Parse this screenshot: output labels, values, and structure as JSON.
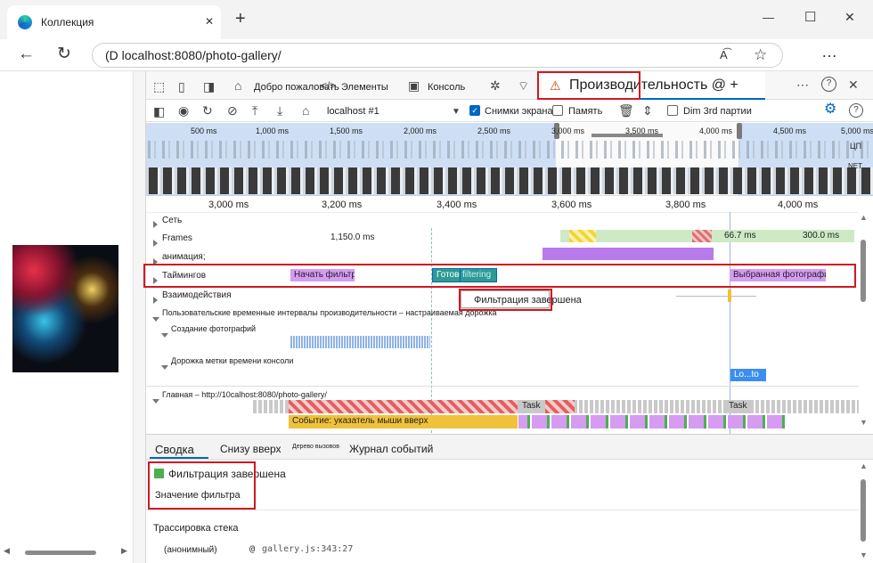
{
  "browser": {
    "tab_title": "Коллекция",
    "new_tab": "+",
    "min": "—",
    "max": "☐",
    "close": "✕",
    "url": "(D localhost:8080/photo-gallery/",
    "read_aloud": "A͡",
    "favorite": "☆",
    "more": "…"
  },
  "devtools": {
    "tabs": [
      {
        "label": "Добро пожаловать"
      },
      {
        "label": "Элементы"
      },
      {
        "label": "Консоль"
      },
      {
        "label": "Производительность @ +"
      }
    ],
    "more": "⋯",
    "help": "?",
    "close": "✕",
    "toolbar": {
      "target": "localhost #1",
      "screenshots": "Снимки экрана",
      "memory": "Память",
      "dim3rd": "Dim 3rd партии",
      "help": "?"
    },
    "overview": {
      "ticks": [
        "500 ms",
        "1,000 ms",
        "1,500 ms",
        "2,000 ms",
        "2,500 ms",
        "3,000 ms",
        "3,500 ms",
        "4,000 ms",
        "4,500 ms",
        "5,000 ms"
      ],
      "cpu": "ЦП",
      "net": "NET"
    },
    "ruler": [
      "3,000 ms",
      "3,200 ms",
      "3,400 ms",
      "3,600 ms",
      "3,800 ms",
      "4,000 ms"
    ],
    "tracks": {
      "network": "Сеть",
      "frames": "Frames",
      "frame_t1": "1,150.0 ms",
      "frame_t2": "66.7 ms",
      "frame_t3": "300.0 ms",
      "animation": "анимация;",
      "timings": "Таймингов",
      "start_filter": "Начать фильтрацию",
      "ready": "Готово",
      "filtering": "filtering",
      "selected_photo": "Выбранная фотография",
      "tooltip": "Фильтрация завершена",
      "interactions": "Взаимодействия",
      "user_timings": "Пользовательские временные интервалы производительности – настраиваемая дорожка",
      "create_photos": "Создание фотографий",
      "console_timestamps": "Дорожка метки времени консоли",
      "console_mark": "Lo...to",
      "main": "Главная – http://10calhost:8080/photo-gallery/",
      "task": "Task",
      "event": "Событие: указатель мыши вверх"
    },
    "bottom": {
      "tabs": [
        "Сводка",
        "Снизу вверх",
        "Дерево вызовов",
        "Журнал событий"
      ],
      "title": "Фильтрация завершена",
      "value": "Значение фильтра",
      "stack_title": "Трассировка стека",
      "fn": "(анонимный)",
      "at": "@",
      "loc": "gallery.js:343:27"
    }
  },
  "colors": {
    "accent": "#0067c0",
    "highlight": "#d01922",
    "timing": "#d59cf2",
    "ready": "#2e9b8f",
    "frames": "#cdeac4",
    "animation": "#b87aea",
    "task": "#c9c9c9",
    "event": "#f0c23b",
    "selected": "#b3d4f7"
  }
}
